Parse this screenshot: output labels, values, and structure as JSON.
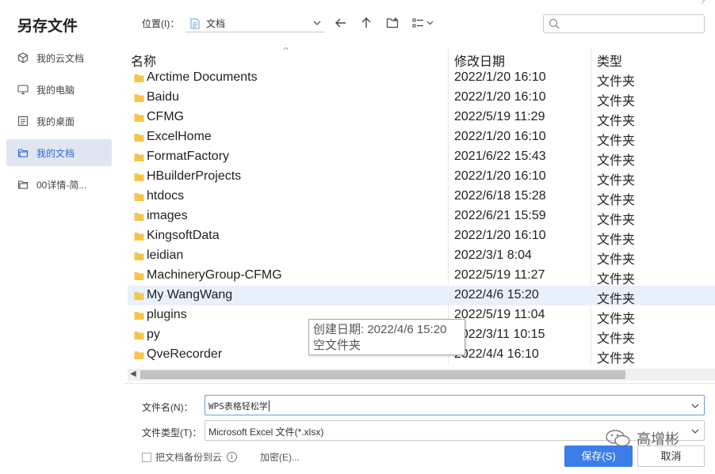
{
  "dialog": {
    "title": "另存文件",
    "corner_glyph": "?"
  },
  "sidebar": {
    "items": [
      {
        "label": "我的云文档",
        "icon": "cloud-doc-icon"
      },
      {
        "label": "我的电脑",
        "icon": "computer-icon"
      },
      {
        "label": "我的桌面",
        "icon": "desktop-icon"
      },
      {
        "label": "我的文档",
        "icon": "documents-icon",
        "active": true
      },
      {
        "label": "00详情-简...",
        "icon": "folder-icon"
      }
    ]
  },
  "toolbar": {
    "location_label": "位置(I)：",
    "location_value": "文档"
  },
  "list": {
    "headers": {
      "name": "名称",
      "date": "修改日期",
      "type": "类型"
    },
    "rows": [
      {
        "name": "Arctime Documents",
        "date": "2022/1/20 16:10",
        "type": "文件夹"
      },
      {
        "name": "Baidu",
        "date": "2022/1/20 16:10",
        "type": "文件夹"
      },
      {
        "name": "CFMG",
        "date": "2022/5/19 11:29",
        "type": "文件夹"
      },
      {
        "name": "ExcelHome",
        "date": "2022/1/20 16:10",
        "type": "文件夹"
      },
      {
        "name": "FormatFactory",
        "date": "2021/6/22 15:43",
        "type": "文件夹"
      },
      {
        "name": "HBuilderProjects",
        "date": "2022/1/20 16:10",
        "type": "文件夹"
      },
      {
        "name": "htdocs",
        "date": "2022/6/18 15:28",
        "type": "文件夹"
      },
      {
        "name": "images",
        "date": "2022/6/21 15:59",
        "type": "文件夹"
      },
      {
        "name": "KingsoftData",
        "date": "2022/1/20 16:10",
        "type": "文件夹"
      },
      {
        "name": "leidian",
        "date": "2022/3/1 8:04",
        "type": "文件夹"
      },
      {
        "name": "MachineryGroup-CFMG",
        "date": "2022/5/19 11:27",
        "type": "文件夹"
      },
      {
        "name": "My WangWang",
        "date": "2022/4/6 15:20",
        "type": "文件夹",
        "hover": true
      },
      {
        "name": "plugins",
        "date": "2022/5/19 11:04",
        "type": "文件夹"
      },
      {
        "name": "py",
        "date": "2022/3/11 10:15",
        "type": "文件夹"
      },
      {
        "name": "QveRecorder",
        "date": "2022/4/4 16:10",
        "type": "文件夹"
      }
    ]
  },
  "tooltip": {
    "line1": "创建日期: 2022/4/6 15:20",
    "line2": "空文件夹"
  },
  "form": {
    "filename_label": "文件名(N)：",
    "filename_value": "WPS表格轻松学",
    "filetype_label": "文件类型(T)：",
    "filetype_value": "Microsoft Excel 文件(*.xlsx)",
    "backup_label": "把文档备份到云",
    "encrypt_label": "加密(E)...",
    "save_label": "保存(S)",
    "cancel_label": "取消"
  },
  "watermark": {
    "text": "高增彬"
  },
  "colors": {
    "accent": "#3b7de9",
    "active_bg": "#dfe6f2",
    "hover_bg": "#e8f1fb",
    "folder": "#f5c54b"
  }
}
